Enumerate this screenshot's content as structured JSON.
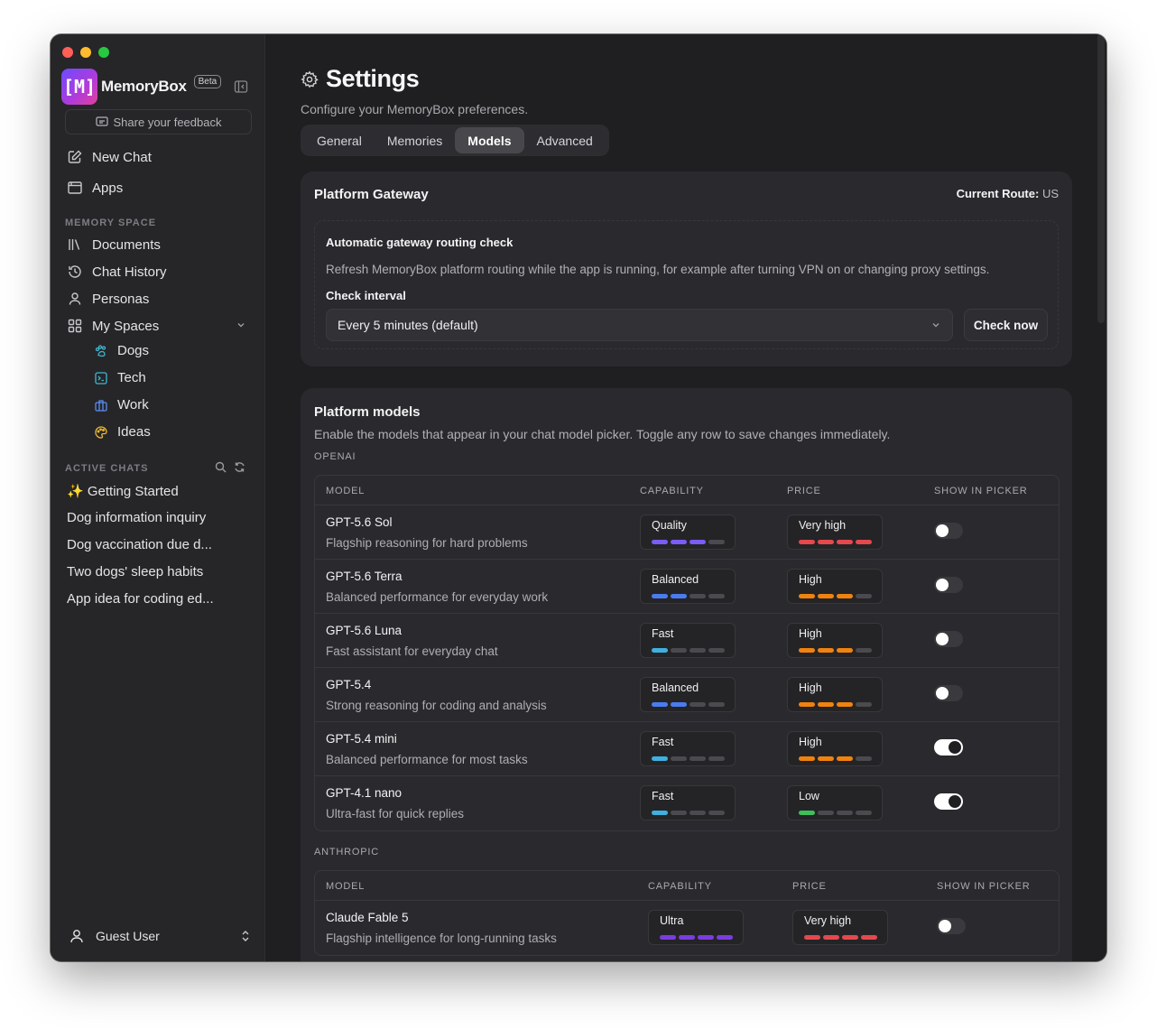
{
  "brand": {
    "name": "MemoryBox",
    "badge": "Beta",
    "logo_text": "[M]"
  },
  "sidebar": {
    "feedback_label": "Share your feedback",
    "nav": {
      "new_chat": "New Chat",
      "apps": "Apps"
    },
    "memory_space_label": "MEMORY SPACE",
    "memory_items": {
      "documents": "Documents",
      "chat_history": "Chat History",
      "personas": "Personas",
      "my_spaces": "My Spaces"
    },
    "spaces": [
      "Dogs",
      "Tech",
      "Work",
      "Ideas"
    ],
    "active_chats_label": "ACTIVE CHATS",
    "chats": [
      "✨ Getting Started",
      "Dog information inquiry",
      "Dog vaccination due d...",
      "Two dogs' sleep habits",
      "App idea for coding ed..."
    ],
    "user": "Guest User"
  },
  "header": {
    "title": "Settings",
    "subtitle": "Configure your MemoryBox preferences.",
    "tabs": [
      "General",
      "Memories",
      "Models",
      "Advanced"
    ],
    "active_tab": "Models"
  },
  "gateway": {
    "title": "Platform Gateway",
    "route_label": "Current Route:",
    "route_value": "US",
    "check_title": "Automatic gateway routing check",
    "check_desc": "Refresh MemoryBox platform routing while the app is running, for example after turning VPN on or changing proxy settings.",
    "interval_label": "Check interval",
    "interval_value": "Every 5 minutes (default)",
    "check_now": "Check now"
  },
  "models": {
    "title": "Platform models",
    "desc": "Enable the models that appear in your chat model picker. Toggle any row to save changes immediately.",
    "columns": {
      "model": "MODEL",
      "capability": "CAPABILITY",
      "price": "PRICE",
      "show": "SHOW IN PICKER"
    },
    "providers": [
      {
        "name": "OPENAI",
        "rows": [
          {
            "name": "GPT-5.6 Sol",
            "desc": "Flagship reasoning for hard problems",
            "capability": "Quality",
            "cap_level": 3,
            "cap_color": "#7b5cf5",
            "price": "Very high",
            "price_level": 4,
            "price_color": "#e5484d",
            "enabled": false
          },
          {
            "name": "GPT-5.6 Terra",
            "desc": "Balanced performance for everyday work",
            "capability": "Balanced",
            "cap_level": 2,
            "cap_color": "#4a7cf0",
            "price": "High",
            "price_level": 3,
            "price_color": "#f0820f",
            "enabled": false
          },
          {
            "name": "GPT-5.6 Luna",
            "desc": "Fast assistant for everyday chat",
            "capability": "Fast",
            "cap_level": 1,
            "cap_color": "#3fb0e0",
            "price": "High",
            "price_level": 3,
            "price_color": "#f0820f",
            "enabled": false
          },
          {
            "name": "GPT-5.4",
            "desc": "Strong reasoning for coding and analysis",
            "capability": "Balanced",
            "cap_level": 2,
            "cap_color": "#4a7cf0",
            "price": "High",
            "price_level": 3,
            "price_color": "#f0820f",
            "enabled": false
          },
          {
            "name": "GPT-5.4 mini",
            "desc": "Balanced performance for most tasks",
            "capability": "Fast",
            "cap_level": 1,
            "cap_color": "#3fb0e0",
            "price": "High",
            "price_level": 3,
            "price_color": "#f0820f",
            "enabled": true
          },
          {
            "name": "GPT-4.1 nano",
            "desc": "Ultra-fast for quick replies",
            "capability": "Fast",
            "cap_level": 1,
            "cap_color": "#3fb0e0",
            "price": "Low",
            "price_level": 1,
            "price_color": "#3fbf5a",
            "enabled": true
          }
        ]
      },
      {
        "name": "ANTHROPIC",
        "rows": [
          {
            "name": "Claude Fable 5",
            "desc": "Flagship intelligence for long-running tasks",
            "capability": "Ultra",
            "cap_level": 4,
            "cap_color": "#7a3de0",
            "price": "Very high",
            "price_level": 4,
            "price_color": "#e5484d",
            "enabled": false
          }
        ]
      }
    ]
  }
}
